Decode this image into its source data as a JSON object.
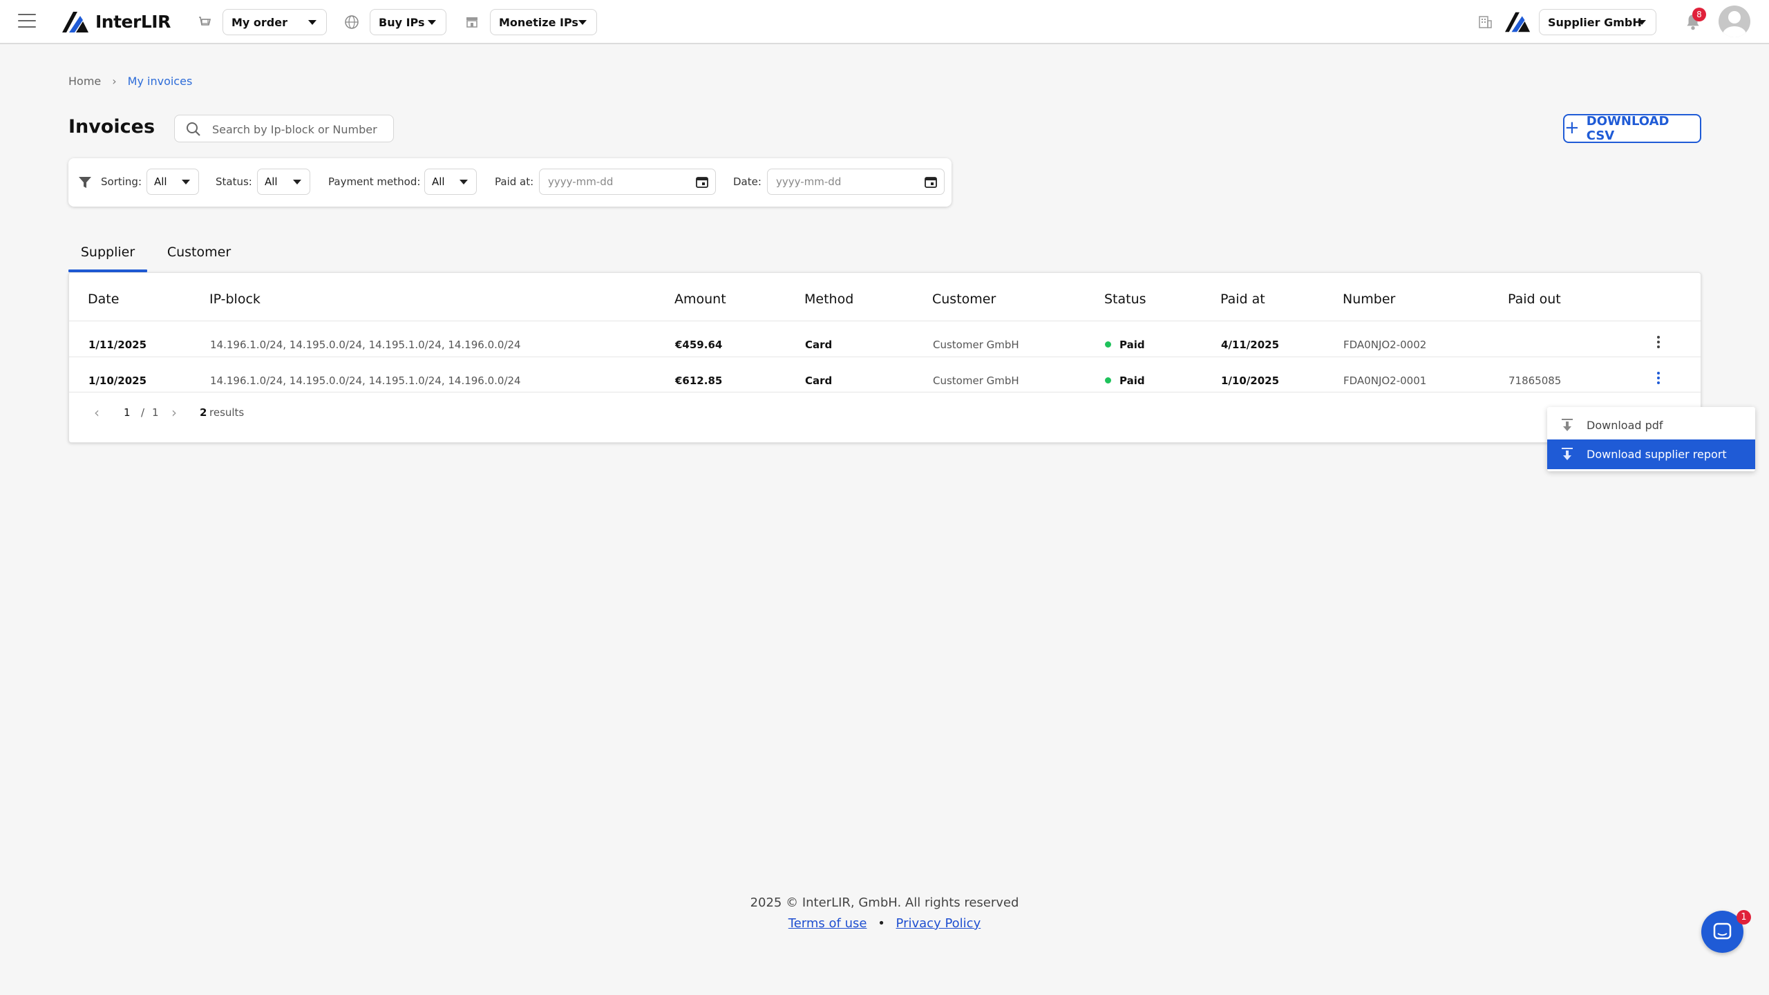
{
  "app": {
    "name": "InterLIR",
    "brand_color": "#1f5bd6"
  },
  "nav": {
    "my_order": "My order",
    "buy_ips": "Buy IPs",
    "monetize_ips": "Monetize IPs",
    "company": "Supplier GmbH",
    "notifications_count": "8"
  },
  "breadcrumb": {
    "home": "Home",
    "current": "My invoices",
    "separator": "›"
  },
  "page": {
    "title": "Invoices",
    "search_placeholder": "Search by Ip-block or Number",
    "download_csv": "DOWNLOAD CSV"
  },
  "filters": {
    "sorting_label": "Sorting:",
    "sorting_value": "All",
    "status_label": "Status:",
    "status_value": "All",
    "payment_label": "Payment method:",
    "payment_value": "All",
    "paid_at_label": "Paid at:",
    "paid_at_placeholder": "yyyy-mm-dd",
    "date_label": "Date:",
    "date_placeholder": "yyyy-mm-dd"
  },
  "tabs": [
    {
      "label": "Supplier",
      "active": true
    },
    {
      "label": "Customer",
      "active": false
    }
  ],
  "table": {
    "headers": [
      "Date",
      "IP-block",
      "Amount",
      "Method",
      "Customer",
      "Status",
      "Paid at",
      "Number",
      "Paid out"
    ],
    "rows": [
      {
        "date": "1/11/2025",
        "ip_block": "14.196.1.0/24, 14.195.0.0/24, 14.195.1.0/24, 14.196.0.0/24",
        "amount": "€459.64",
        "method": "Card",
        "customer": "Customer GmbH",
        "status": "Paid",
        "paid_at": "4/11/2025",
        "number": "FDA0NJO2-0002",
        "paid_out": ""
      },
      {
        "date": "1/10/2025",
        "ip_block": "14.196.1.0/24, 14.195.0.0/24, 14.195.1.0/24, 14.196.0.0/24",
        "amount": "€612.85",
        "method": "Card",
        "customer": "Customer GmbH",
        "status": "Paid",
        "paid_at": "1/10/2025",
        "number": "FDA0NJO2-0001",
        "paid_out": "71865085"
      }
    ],
    "status_color": "#1ec25b"
  },
  "pagination": {
    "current": "1",
    "separator": "/",
    "total": "1",
    "results_count": "2",
    "results_label": "results"
  },
  "row_menu": {
    "items": [
      "Download pdf",
      "Download supplier report"
    ],
    "highlighted": "Download supplier report"
  },
  "footer": {
    "copyright": "2025 © InterLIR, GmbH. All rights reserved",
    "terms": "Terms of use",
    "bullet": "•",
    "privacy": "Privacy Policy"
  },
  "chat": {
    "badge": "1"
  }
}
